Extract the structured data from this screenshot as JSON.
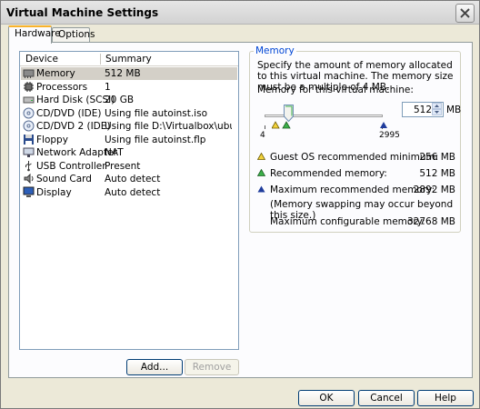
{
  "window": {
    "title": "Virtual Machine Settings"
  },
  "tabs": [
    {
      "label": "Hardware"
    },
    {
      "label": "Options"
    }
  ],
  "device_list": {
    "columns": {
      "device": "Device",
      "summary": "Summary"
    },
    "rows": [
      {
        "device": "Memory",
        "summary": "512 MB",
        "icon": "memory-icon"
      },
      {
        "device": "Processors",
        "summary": "1",
        "icon": "processor-icon"
      },
      {
        "device": "Hard Disk (SCSI)",
        "summary": "20 GB",
        "icon": "hard-disk-icon"
      },
      {
        "device": "CD/DVD (IDE)",
        "summary": "Using file autoinst.iso",
        "icon": "cd-dvd-icon"
      },
      {
        "device": "CD/DVD 2 (IDE)",
        "summary": "Using file D:\\Virtualbox\\ubun...",
        "icon": "cd-dvd-icon"
      },
      {
        "device": "Floppy",
        "summary": "Using file autoinst.flp",
        "icon": "floppy-icon"
      },
      {
        "device": "Network Adapter",
        "summary": "NAT",
        "icon": "network-adapter-icon"
      },
      {
        "device": "USB Controller",
        "summary": "Present",
        "icon": "usb-icon"
      },
      {
        "device": "Sound Card",
        "summary": "Auto detect",
        "icon": "sound-card-icon"
      },
      {
        "device": "Display",
        "summary": "Auto detect",
        "icon": "display-icon"
      }
    ],
    "selected_row": "Memory",
    "add_label": "Add...",
    "remove_label": "Remove"
  },
  "memory": {
    "group_title": "Memory",
    "description": "Specify the amount of memory allocated to this virtual machine. The memory size must be a multiple of 4 MB.",
    "field_label": "Memory for this virtual machine:",
    "value": "512",
    "unit": "MB",
    "slider": {
      "min_label": "4",
      "max_label": "2995"
    },
    "guest_min": {
      "label": "Guest OS recommended minimum:",
      "value": "256 MB"
    },
    "recommended": {
      "label": "Recommended memory:",
      "value": "512 MB"
    },
    "max_recommended": {
      "label": "Maximum recommended memory:",
      "value": "2892 MB",
      "note": "(Memory swapping may occur beyond this size.)"
    },
    "max_configurable": {
      "label": "Maximum configurable memory:",
      "value": "32768 MB"
    }
  },
  "buttons": {
    "ok": "OK",
    "cancel": "Cancel",
    "help": "Help"
  },
  "colors": {
    "yellow_marker": "#f2d13a",
    "green_marker": "#3cb04a",
    "blue_marker": "#1f3c9c",
    "selection": "#d4d0c8"
  }
}
